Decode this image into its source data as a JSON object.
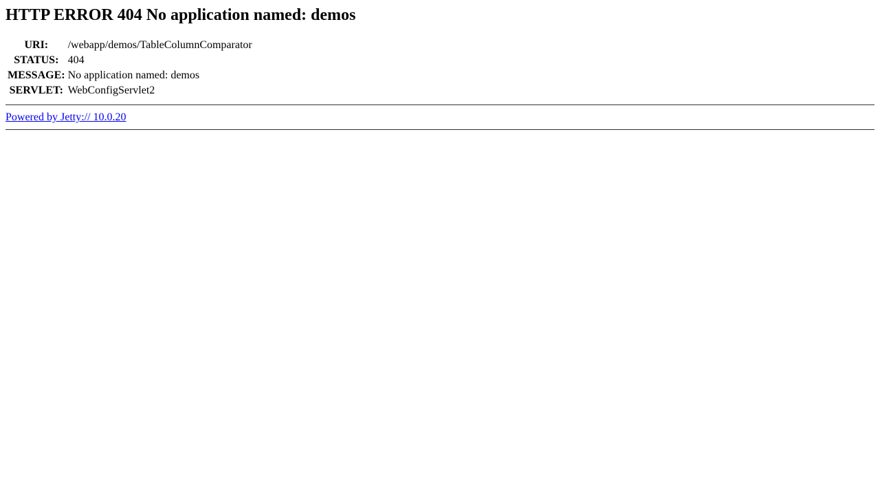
{
  "page": {
    "title": "HTTP ERROR 404 No application named: demos"
  },
  "details": [
    {
      "label": "URI:",
      "value": "/webapp/demos/TableColumnComparator"
    },
    {
      "label": "STATUS:",
      "value": "404"
    },
    {
      "label": "MESSAGE:",
      "value": "No application named: demos"
    },
    {
      "label": "SERVLET:",
      "value": "WebConfigServlet2"
    }
  ],
  "footer": {
    "link_text": "Powered by Jetty:// 10.0.20"
  },
  "colors": {
    "link": "#0000ee",
    "text": "#000000",
    "background": "#ffffff"
  }
}
